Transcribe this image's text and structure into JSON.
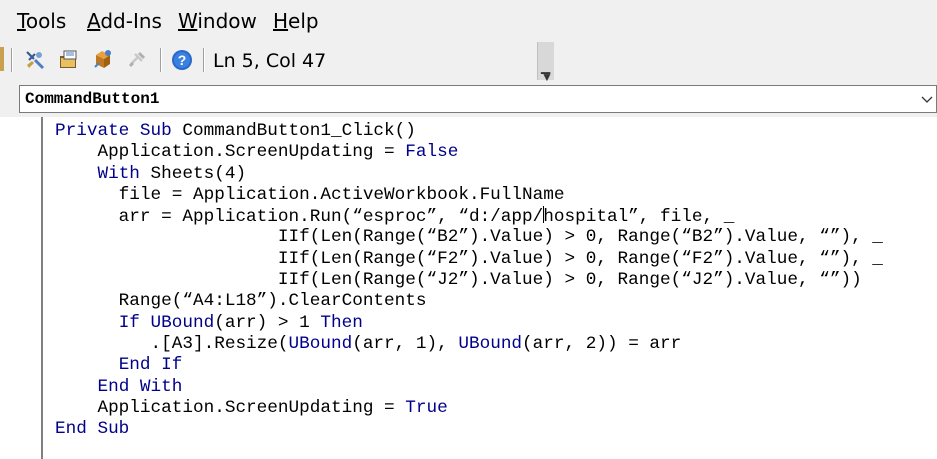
{
  "menubar": {
    "items": [
      {
        "accel": "T",
        "rest": "ools"
      },
      {
        "accel": "A",
        "rest": "dd-Ins"
      },
      {
        "accel": "W",
        "rest": "indow"
      },
      {
        "accel": "H",
        "rest": "elp"
      }
    ]
  },
  "toolbar": {
    "icons": [
      "design-mode-icon",
      "project-explorer-icon",
      "properties-window-icon",
      "toolbox-icon",
      "help-icon"
    ],
    "status": "Ln 5, Col 47"
  },
  "object_combo": {
    "value": "CommandButton1"
  },
  "code": {
    "lines": [
      [
        {
          "t": "Private Sub",
          "k": true
        },
        {
          "t": " CommandButton1_Click()"
        }
      ],
      [
        {
          "t": "    Application.ScreenUpdating = "
        },
        {
          "t": "False",
          "k": true
        }
      ],
      [
        {
          "t": "    "
        },
        {
          "t": "With",
          "k": true
        },
        {
          "t": " Sheets(4)"
        }
      ],
      [
        {
          "t": "      file = Application.ActiveWorkbook.FullName"
        }
      ],
      [
        {
          "t": "      arr = Application.Run(“esproc”, “d:/app/"
        },
        {
          "cursor": true
        },
        {
          "t": "hospital”, file, _"
        }
      ],
      [
        {
          "t": "                     IIf(Len(Range(“B2”).Value) > 0, Range(“B2”).Value, “”), _"
        }
      ],
      [
        {
          "t": "                     IIf(Len(Range(“F2”).Value) > 0, Range(“F2”).Value, “”), _"
        }
      ],
      [
        {
          "t": "                     IIf(Len(Range(“J2”).Value) > 0, Range(“J2”).Value, “”))"
        }
      ],
      [
        {
          "t": "      Range(“A4:L18”).ClearContents"
        }
      ],
      [
        {
          "t": "      "
        },
        {
          "t": "If UBound",
          "k": true
        },
        {
          "t": "(arr) > 1 "
        },
        {
          "t": "Then",
          "k": true
        }
      ],
      [
        {
          "t": "         .[A3].Resize("
        },
        {
          "t": "UBound",
          "k": true
        },
        {
          "t": "(arr, 1), "
        },
        {
          "t": "UBound",
          "k": true
        },
        {
          "t": "(arr, 2)) = arr"
        }
      ],
      [
        {
          "t": "      "
        },
        {
          "t": "End If",
          "k": true
        }
      ],
      [
        {
          "t": "    "
        },
        {
          "t": "End With",
          "k": true
        }
      ],
      [
        {
          "t": "    Application.ScreenUpdating = "
        },
        {
          "t": "True",
          "k": true
        }
      ],
      [
        {
          "t": "End Sub",
          "k": true
        }
      ]
    ]
  },
  "colors": {
    "keyword": "#00008b",
    "text": "#000000",
    "background": "#ffffff",
    "chrome": "#f0f0f0"
  }
}
